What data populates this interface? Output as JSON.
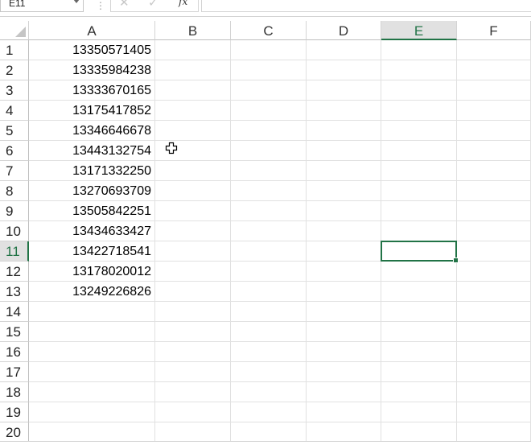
{
  "formula_bar": {
    "name_box": "E11",
    "separator": "⋮",
    "cancel_icon": "✕",
    "enter_icon": "✓",
    "fx_label": "fx",
    "formula_value": ""
  },
  "columns": [
    "A",
    "B",
    "C",
    "D",
    "E",
    "F"
  ],
  "rows": [
    "1",
    "2",
    "3",
    "4",
    "5",
    "6",
    "7",
    "8",
    "9",
    "10",
    "11",
    "12",
    "13",
    "14",
    "15",
    "16",
    "17",
    "18",
    "19",
    "20"
  ],
  "cells_A": [
    "13350571405",
    "13335984238",
    "13333670165",
    "13175417852",
    "13346646678",
    "13443132754",
    "13171332250",
    "13270693709",
    "13505842251",
    "13434633427",
    "13422718541",
    "13178020012",
    "13249226826"
  ],
  "selection": {
    "active_cell": "E11",
    "column": "E",
    "row": "11"
  },
  "colors": {
    "accent": "#217346",
    "gridline": "#e1e1e1",
    "header_selected_bg": "#e1e1e1"
  },
  "cursor_icon": "cell-select-cross-cursor"
}
